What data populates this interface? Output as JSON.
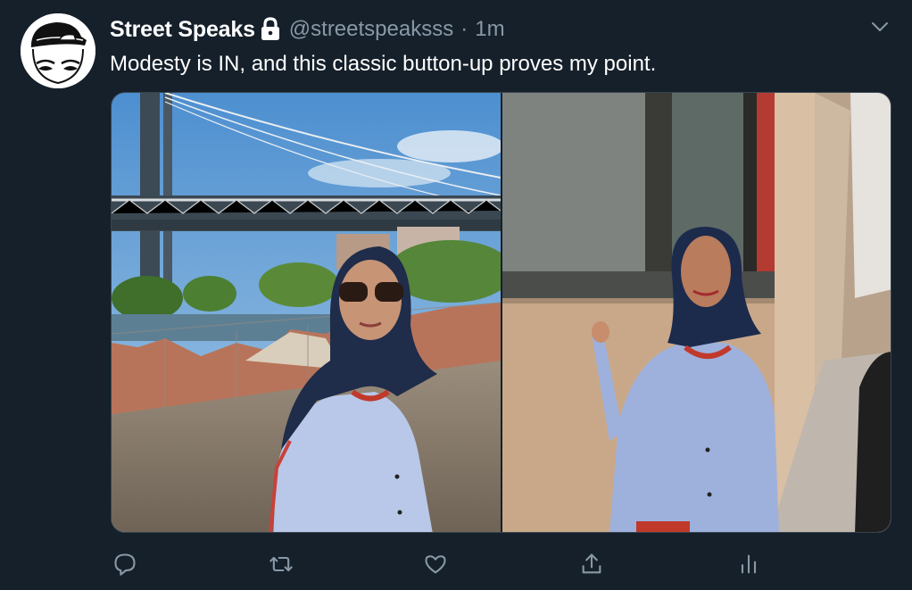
{
  "tweet": {
    "display_name": "Street Speaks",
    "handle": "@streetspeaksss",
    "separator": "·",
    "time": "1m",
    "text": "Modesty is IN, and this classic button-up proves my point.",
    "protected": true
  },
  "media": {
    "images": [
      {
        "name": "photo-bridge"
      },
      {
        "name": "photo-wall"
      }
    ]
  },
  "actions": [
    {
      "name": "reply",
      "icon": "reply-icon"
    },
    {
      "name": "retweet",
      "icon": "retweet-icon"
    },
    {
      "name": "like",
      "icon": "heart-icon"
    },
    {
      "name": "share",
      "icon": "share-icon"
    },
    {
      "name": "analytics",
      "icon": "analytics-icon"
    }
  ],
  "colors": {
    "background": "#15202b",
    "text_primary": "#ffffff",
    "text_secondary": "#8899a6",
    "border": "#38444d"
  }
}
